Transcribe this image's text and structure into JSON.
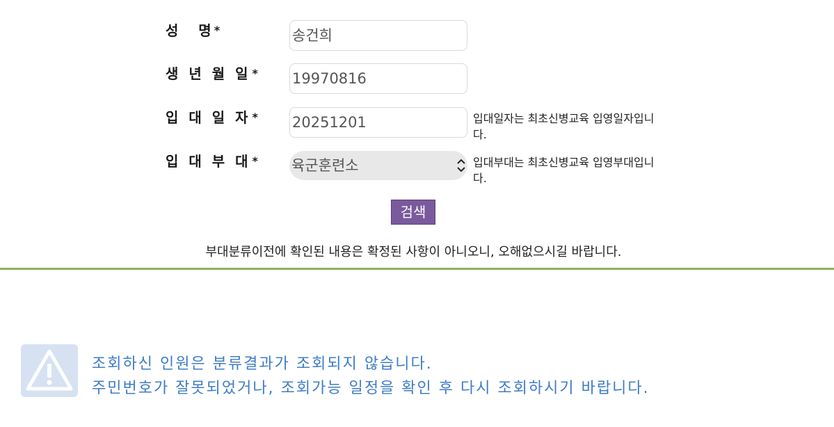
{
  "form": {
    "name_label": "성   명",
    "birth_label": "생 년 월 일",
    "enlist_date_label": "입 대 일 자",
    "unit_label": "입 대 부 대",
    "required_mark": "*",
    "name_value": "송건희",
    "birth_value": "19970816",
    "enlist_date_value": "20251201",
    "unit_value": "육군훈련소",
    "enlist_date_note": "입대일자는 최초신병교육 입영일자입니다.",
    "unit_note": "입대부대는 최초신병교육 입영부대입니다.",
    "search_label": "검색"
  },
  "notice": "부대분류이전에 확인된 내용은 확정된 사항이 아니오니, 오해없으시길 바랍니다.",
  "result": {
    "line1": "조회하신 인원은 분류결과가 조회되지 않습니다.",
    "line2": "주민번호가 잘못되었거나, 조회가능 일정을 확인 후 다시 조회하시기 바랍니다.",
    "icon": "warning-icon"
  },
  "colors": {
    "button": "#7a5a9c",
    "divider": "#8fb15c",
    "warning_text": "#3f7cc6",
    "warning_icon_bg": "#d6e2f2"
  }
}
